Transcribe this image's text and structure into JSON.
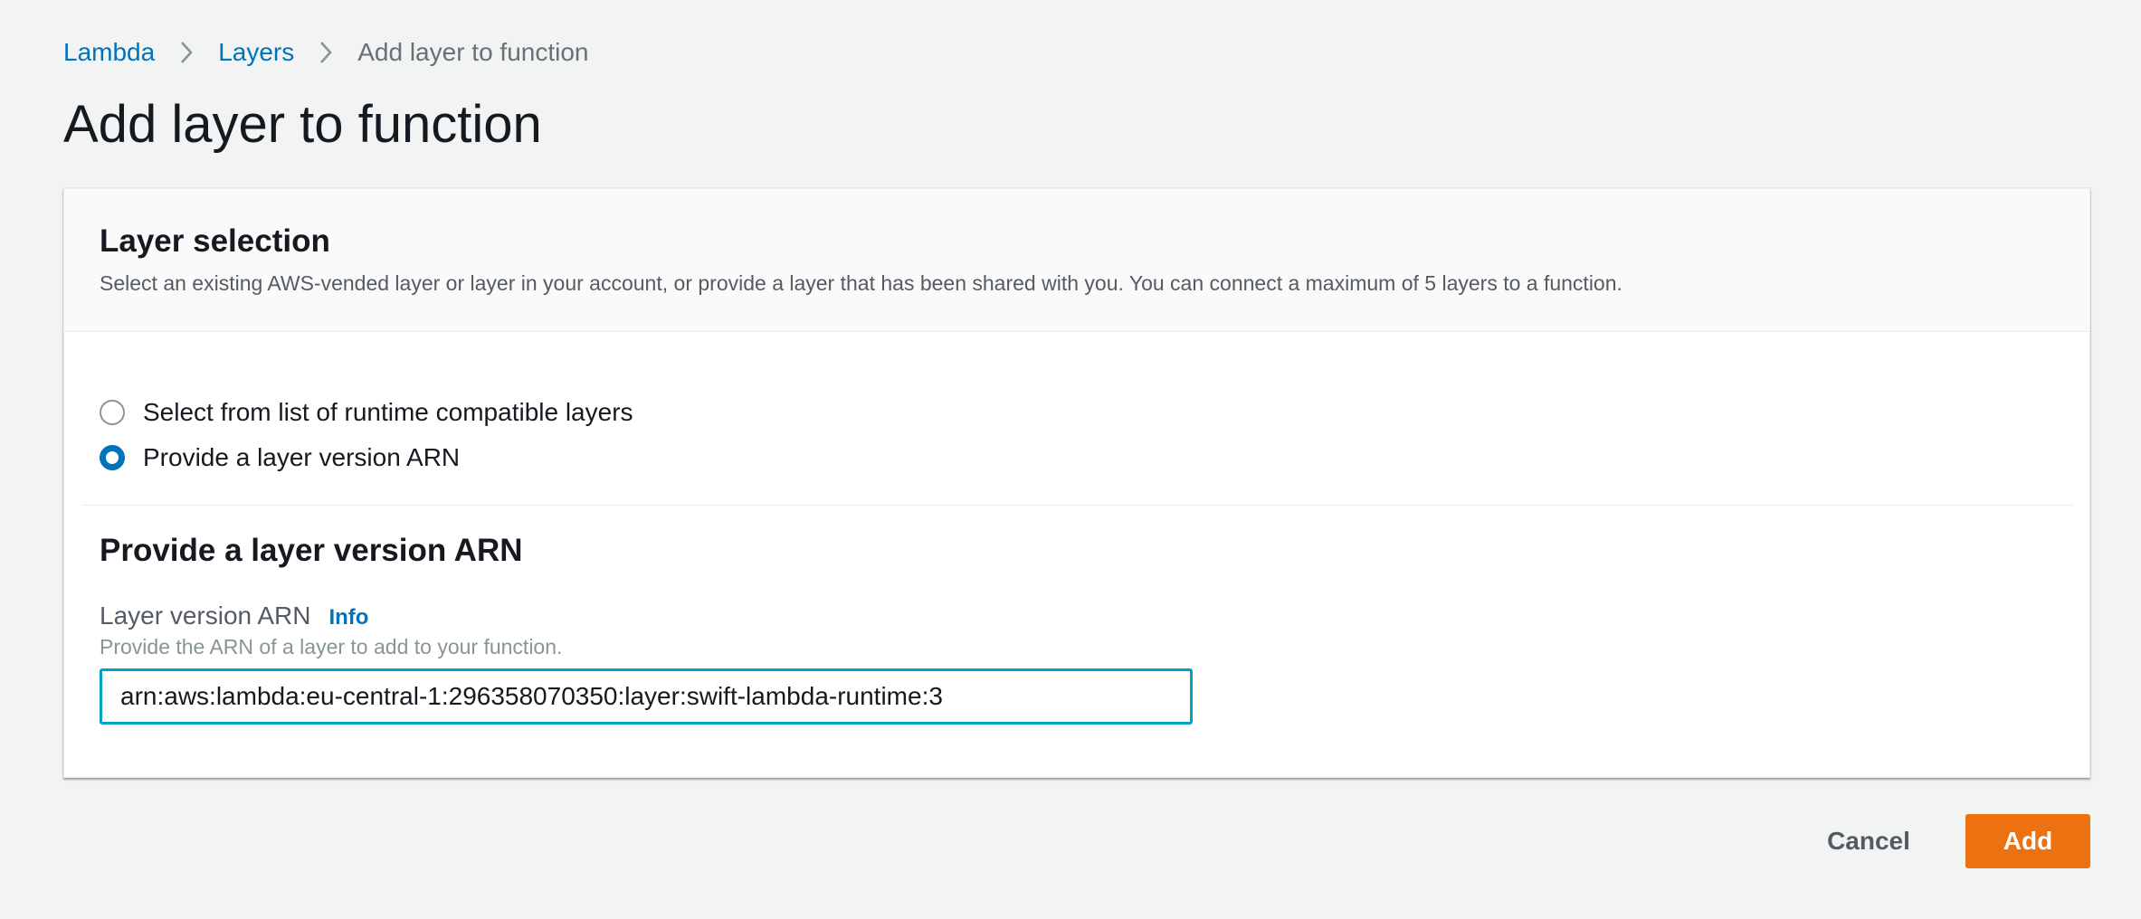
{
  "breadcrumb": {
    "items": [
      {
        "label": "Lambda"
      },
      {
        "label": "Layers"
      },
      {
        "label": "Add layer to function"
      }
    ]
  },
  "page": {
    "title": "Add layer to function"
  },
  "layer_selection": {
    "title": "Layer selection",
    "description": "Select an existing AWS-vended layer or layer in your account, or provide a layer that has been shared with you. You can connect a maximum of 5 layers to a function.",
    "options": [
      {
        "label": "Select from list of runtime compatible layers",
        "checked": false
      },
      {
        "label": "Provide a layer version ARN",
        "checked": true
      }
    ]
  },
  "arn_section": {
    "title": "Provide a layer version ARN",
    "field_label": "Layer version ARN",
    "info_label": "Info",
    "field_description": "Provide the ARN of a layer to add to your function.",
    "value": "arn:aws:lambda:eu-central-1:296358070350:layer:swift-lambda-runtime:3"
  },
  "footer": {
    "cancel_label": "Cancel",
    "add_label": "Add"
  },
  "colors": {
    "link": "#0073bb",
    "primary_button": "#ec7211",
    "input_focus": "#00a1c9",
    "background": "#f2f3f3"
  },
  "icons": {
    "breadcrumb_separator": "chevron-right-icon"
  }
}
